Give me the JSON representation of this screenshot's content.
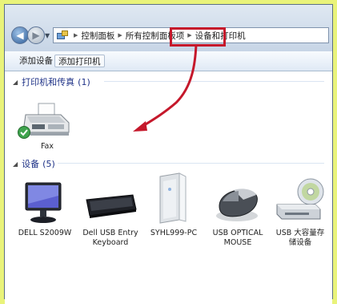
{
  "window": {
    "breadcrumb": [
      "控制面板",
      "所有控制面板项",
      "设备和打印机"
    ]
  },
  "toolbar": {
    "add_device": "添加设备",
    "add_printer": "添加打印机"
  },
  "groups": {
    "printers": {
      "title": "打印机和传真",
      "count": "(1)"
    },
    "devices": {
      "title": "设备",
      "count": "(5)"
    }
  },
  "printers": [
    {
      "label": "Fax",
      "icon": "fax-icon",
      "status": "default-check"
    }
  ],
  "devices": [
    {
      "label": "DELL S2009W",
      "icon": "monitor-icon"
    },
    {
      "label": "Dell USB Entry Keyboard",
      "icon": "keyboard-icon"
    },
    {
      "label": "SYHL999-PC",
      "icon": "pc-tower-icon"
    },
    {
      "label": "USB OPTICAL MOUSE",
      "icon": "mouse-icon"
    },
    {
      "label": "USB 大容量存储设备",
      "icon": "storage-drive-icon"
    }
  ],
  "colors": {
    "highlight": "#c5182b",
    "group_text": "#1e3287",
    "background": "#e9f37a"
  }
}
